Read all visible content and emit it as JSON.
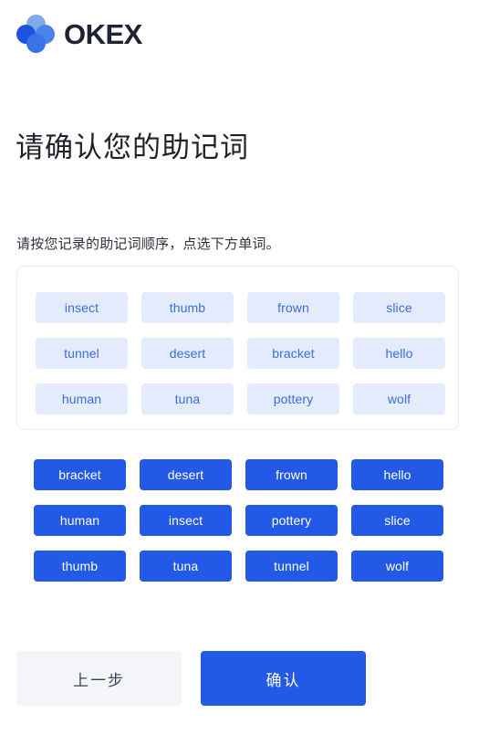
{
  "brand": {
    "name": "OKEX",
    "logo_icon": "okex-four-dot-logo",
    "dot_colors": {
      "top": "#7fabe9",
      "left": "#1c54e0",
      "right": "#4a81ea",
      "bottom": "#3a72e8"
    }
  },
  "page": {
    "title": "请确认您的助记词",
    "subtitle": "请按您记录的助记词顺序，点选下方单词。",
    "background": "#ffffff"
  },
  "selected_area": {
    "border_color": "#e7eaef",
    "chip_background": "#e4ebfd",
    "chip_text_color": "#3a6fd8",
    "words": [
      "insect",
      "thumb",
      "frown",
      "slice",
      "tunnel",
      "desert",
      "bracket",
      "hello",
      "human",
      "tuna",
      "pottery",
      "wolf"
    ]
  },
  "word_bank": {
    "chip_background": "#2259e6",
    "chip_text_color": "#ffffff",
    "words": [
      "bracket",
      "desert",
      "frown",
      "hello",
      "human",
      "insect",
      "pottery",
      "slice",
      "thumb",
      "tuna",
      "tunnel",
      "wolf"
    ]
  },
  "actions": {
    "back_label": "上一步",
    "back_background": "#f3f5f8",
    "back_text_color": "#3a4559",
    "confirm_label": "确认",
    "confirm_background": "#2259e6",
    "confirm_text_color": "#ffffff"
  }
}
